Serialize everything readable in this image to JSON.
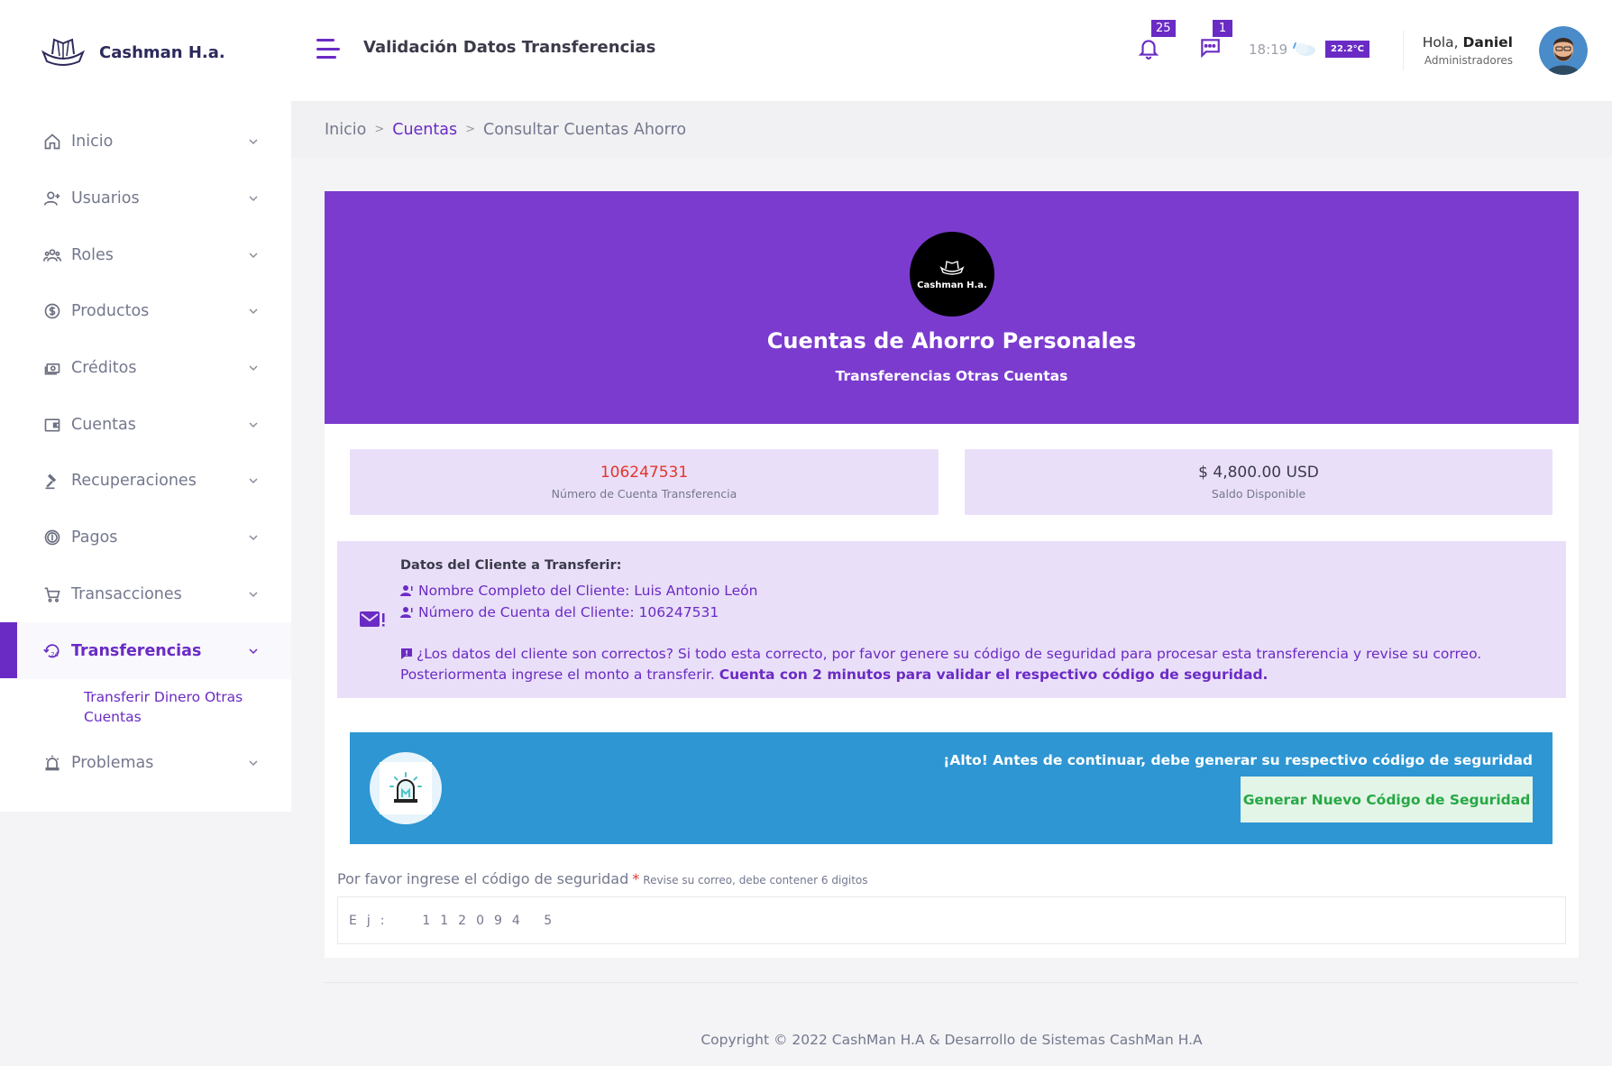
{
  "brand": {
    "name": "Cashman H.a.",
    "logo_icon": "ship-logo-icon"
  },
  "sidebar": {
    "items": [
      {
        "label": "Inicio",
        "icon": "home-icon"
      },
      {
        "label": "Usuarios",
        "icon": "user-plus-icon"
      },
      {
        "label": "Roles",
        "icon": "users-group-icon"
      },
      {
        "label": "Productos",
        "icon": "dollar-circle-icon"
      },
      {
        "label": "Créditos",
        "icon": "money-icon"
      },
      {
        "label": "Cuentas",
        "icon": "wallet-icon"
      },
      {
        "label": "Recuperaciones",
        "icon": "gavel-icon"
      },
      {
        "label": "Pagos",
        "icon": "coin-icon"
      },
      {
        "label": "Transacciones",
        "icon": "cart-icon"
      },
      {
        "label": "Transferencias",
        "icon": "history-24-icon",
        "active": true
      },
      {
        "label": "Problemas",
        "icon": "alarm-icon"
      }
    ],
    "subitem": "Transferir Dinero Otras Cuentas"
  },
  "header": {
    "title": "Validación Datos Transferencias",
    "notifications_count": "25",
    "messages_count": "1",
    "time": "18:19",
    "temperature": "22.2°C",
    "greeting_prefix": "Hola,",
    "user_name": "Daniel",
    "user_role": "Administradores"
  },
  "breadcrumb": {
    "home": "Inicio",
    "section": "Cuentas",
    "current": "Consultar Cuentas Ahorro"
  },
  "hero": {
    "logo_text": "Cashman H.a.",
    "title": "Cuentas de Ahorro Personales",
    "subtitle": "Transferencias Otras Cuentas"
  },
  "stats": {
    "account_number": "106247531",
    "account_label": "Número de Cuenta Transferencia",
    "balance": "$ 4,800.00 USD",
    "balance_label": "Saldo Disponible"
  },
  "client": {
    "heading": "Datos del Cliente a Transferir:",
    "name_line": "Nombre Completo del Cliente: Luis Antonio León",
    "account_line": "Número de Cuenta del Cliente: 106247531",
    "message": "¿Los datos del cliente son correctos? Si todo esta correcto, por favor genere su código de seguridad para procesar esta transferencia y revise su correo. Posteriormenta ingrese el monto a transferir.",
    "message_bold": "Cuenta con 2 minutos para validar el respectivo código de seguridad."
  },
  "alert": {
    "text": "¡Alto! Antes de continuar, debe generar su respectivo código de seguridad",
    "button": "Generar Nuevo Código de Seguridad"
  },
  "code": {
    "label": "Por favor ingrese el código de seguridad",
    "required_mark": "*",
    "hint": "Revise su correo, debe contener 6 digitos",
    "placeholder": "Ej:  112094 5"
  },
  "footer": {
    "text": "Copyright © 2022 CashMan H.A & Desarrollo de Sistemas CashMan H.A"
  },
  "colors": {
    "accent": "#7b3bcf",
    "alert_blue": "#2d96d3",
    "success": "#27a844",
    "danger": "#e2352b"
  }
}
